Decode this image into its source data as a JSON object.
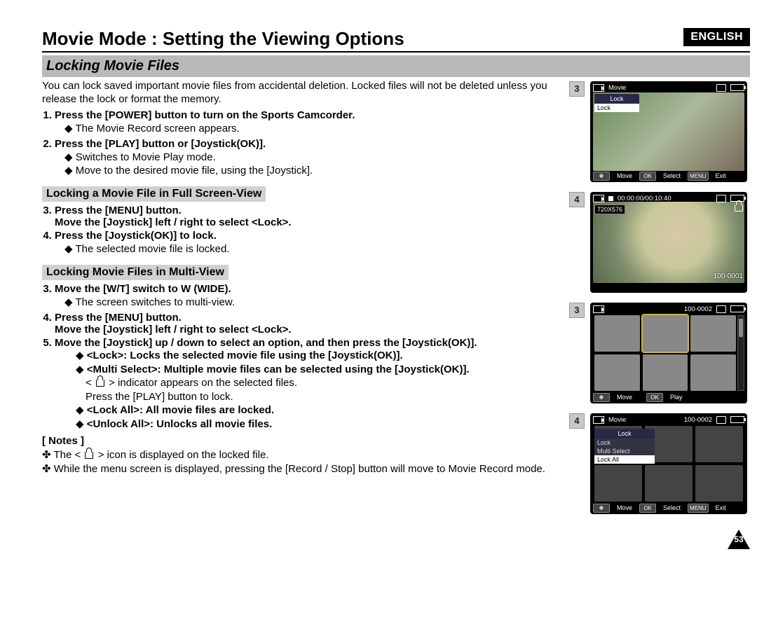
{
  "lang_badge": "ENGLISH",
  "title": "Movie Mode : Setting the Viewing Options",
  "section": "Locking Movie Files",
  "intro": "You can lock saved important movie files from accidental deletion. Locked files will not be deleted unless you release the lock or format the memory.",
  "step1": "Press the [POWER] button to turn on the Sports Camcorder.",
  "step1_sub1": "The Movie Record screen appears.",
  "step2": "Press the [PLAY] button or [Joystick(OK)].",
  "step2_sub1": "Switches to Movie Play mode.",
  "step2_sub2": "Move to the desired movie file, using the [Joystick].",
  "head_full": "Locking a Movie File in Full Screen-View",
  "full3a": "Press the [MENU] button.",
  "full3b": "Move the [Joystick] left / right to select <Lock>.",
  "full4": "Press the [Joystick(OK)] to lock.",
  "full4_sub": "The selected movie file is locked.",
  "head_multi": "Locking Movie Files in Multi-View",
  "multi3": "Move the [W/T] switch to W (WIDE).",
  "multi3_sub": "The screen switches to multi-view.",
  "multi4a": "Press the [MENU] button.",
  "multi4b": "Move the [Joystick] left / right to select <Lock>.",
  "multi5a": "Move the [Joystick] up / down to select an option, and then press the [Joystick(OK)].",
  "opt_lock": "<Lock>: Locks the selected movie file using the [Joystick(OK)].",
  "opt_multi_a": "<Multi Select>: Multiple movie files can be selected using the [Joystick(OK)].",
  "opt_multi_b": "indicator appears on the selected files.",
  "opt_multi_c": "Press the [PLAY] button to lock.",
  "opt_lockall": "<Lock All>: All movie files are locked.",
  "opt_unlockall": "<Unlock All>: Unlocks all movie files.",
  "notes_label": "[ Notes ]",
  "note1a": "The < ",
  "note1b": " > icon is displayed on the locked file.",
  "note2": "While the menu screen is displayed, pressing the [Record / Stop] button will move to Movie Record mode.",
  "pagenum": "53",
  "shots": {
    "s1": {
      "step": "3",
      "top_mode": "Movie",
      "menu_head": "Lock",
      "menu_item": "Lock",
      "bot_move": "Move",
      "bot_ok": "OK",
      "bot_sel": "Select",
      "bot_menu": "MENU",
      "bot_exit": "Exit"
    },
    "s2": {
      "step": "4",
      "timecode": "00:00:00/00:10:40",
      "res": "720X576",
      "file": "100-0001"
    },
    "s3": {
      "step": "3",
      "file": "100-0002",
      "bot_move": "Move",
      "bot_ok": "OK",
      "bot_play": "Play"
    },
    "s4": {
      "step": "4",
      "top_mode": "Movie",
      "file": "100-0002",
      "menu_head": "Lock",
      "menu_i1": "Lock",
      "menu_i2": "Multi Select",
      "menu_i3": "Lock All",
      "bot_move": "Move",
      "bot_ok": "OK",
      "bot_sel": "Select",
      "bot_menu": "MENU",
      "bot_exit": "Exit"
    }
  }
}
